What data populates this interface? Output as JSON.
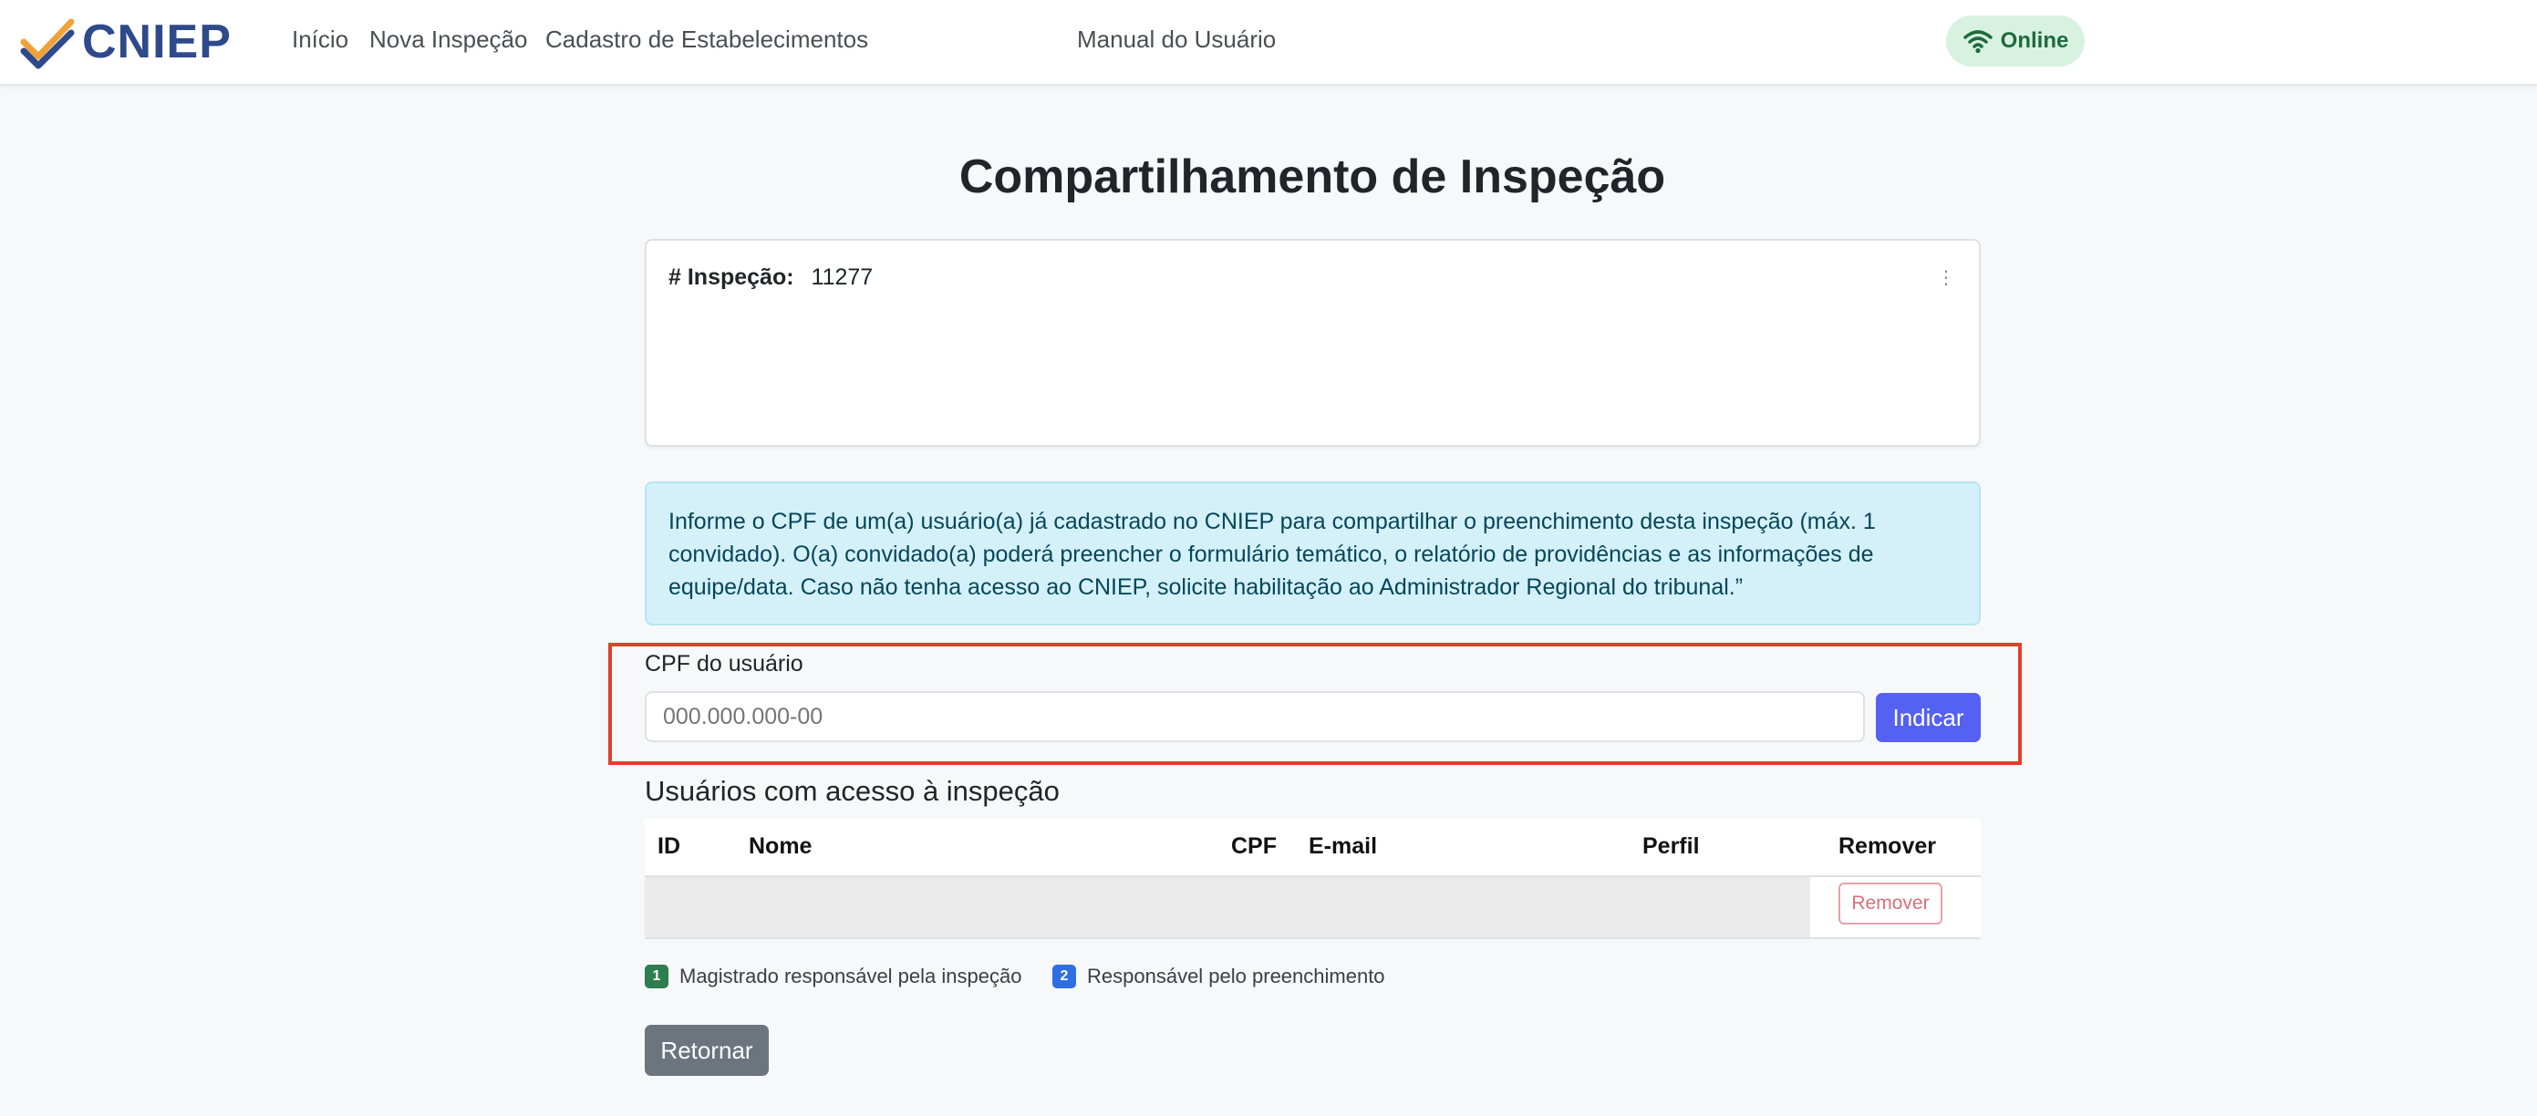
{
  "brand": {
    "name": "CNIEP",
    "logo_icon": "check-logo-icon",
    "color": "#2f4a8a"
  },
  "nav": {
    "items": [
      {
        "label": "Início"
      },
      {
        "label": "Nova Inspeção"
      },
      {
        "label": "Cadastro de Estabelecimentos"
      },
      {
        "label": "Manual do Usuário"
      }
    ],
    "status": {
      "label": "Online",
      "icon": "wifi-icon",
      "color": "#1e6b3b"
    }
  },
  "page": {
    "title": "Compartilhamento de Inspeção"
  },
  "inspection_card": {
    "label": "# Inspeção:",
    "value": "11277",
    "dots": "⋮"
  },
  "alert": {
    "text": "Informe o CPF de um(a) usuário(a) já cadastrado no CNIEP para compartilhar o preenchimento desta inspeção (máx. 1 convidado). O(a) convidado(a) poderá preencher o formulário temático, o relatório de providências e as informações de equipe/data. Caso não tenha acesso ao CNIEP, solicite habilitação ao Administrador Regional do tribunal.”"
  },
  "cpf_form": {
    "label": "CPF do usuário",
    "placeholder": "000.000.000-00",
    "value": "",
    "submit_label": "Indicar",
    "accent": "#5561f2",
    "highlight_color": "#e0402a"
  },
  "users_table": {
    "title": "Usuários com acesso à inspeção",
    "columns": [
      "ID",
      "Nome",
      "CPF",
      "E-mail",
      "Perfil",
      "Remover"
    ],
    "rows": [
      {
        "id": "",
        "nome": "",
        "cpf": "",
        "email": "",
        "perfil": "",
        "remove_label": "Remover"
      }
    ]
  },
  "legend": [
    {
      "badge": "1",
      "label": "Magistrado responsável pela inspeção",
      "color": "#2e7d4f"
    },
    {
      "badge": "2",
      "label": "Responsável pelo preenchimento",
      "color": "#2f6fe0"
    }
  ],
  "actions": {
    "back_label": "Retornar"
  }
}
